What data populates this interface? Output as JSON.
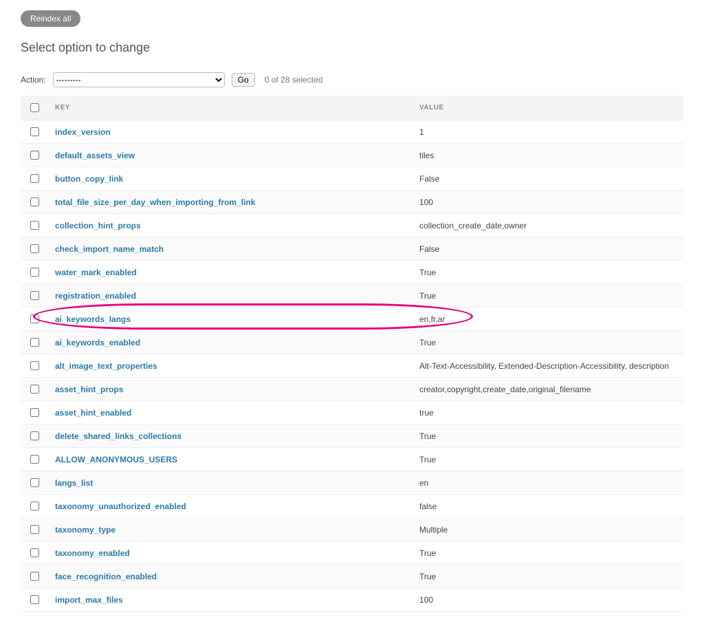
{
  "toolbar": {
    "reindex_label": "Reindex all"
  },
  "page_title": "Select option to change",
  "actions": {
    "label": "Action:",
    "placeholder": "---------",
    "go_label": "Go",
    "selection_count": "0 of 28 selected"
  },
  "table": {
    "header_key": "KEY",
    "header_value": "VALUE",
    "rows": [
      {
        "key": "index_version",
        "value": "1",
        "highlight": false
      },
      {
        "key": "default_assets_view",
        "value": "tiles",
        "highlight": false
      },
      {
        "key": "button_copy_link",
        "value": "False",
        "highlight": false
      },
      {
        "key": "total_file_size_per_day_when_importing_from_link",
        "value": "100",
        "highlight": false
      },
      {
        "key": "collection_hint_props",
        "value": "collection_create_date,owner",
        "highlight": false
      },
      {
        "key": "check_import_name_match",
        "value": "False",
        "highlight": false
      },
      {
        "key": "water_mark_enabled",
        "value": "True",
        "highlight": false
      },
      {
        "key": "registration_enabled",
        "value": "True",
        "highlight": false
      },
      {
        "key": "ai_keywords_langs",
        "value": "en,fr,ar",
        "highlight": true
      },
      {
        "key": "ai_keywords_enabled",
        "value": "True",
        "highlight": false
      },
      {
        "key": "alt_image_text_properties",
        "value": "Alt-Text-Accessibility, Extended-Description-Accessibility, description",
        "highlight": false
      },
      {
        "key": "asset_hint_props",
        "value": "creator,copyright,create_date,original_filename",
        "highlight": false
      },
      {
        "key": "asset_hint_enabled",
        "value": "true",
        "highlight": false
      },
      {
        "key": "delete_shared_links_collections",
        "value": "True",
        "highlight": false
      },
      {
        "key": "ALLOW_ANONYMOUS_USERS",
        "value": "True",
        "highlight": false
      },
      {
        "key": "langs_list",
        "value": "en",
        "highlight": false
      },
      {
        "key": "taxonomy_unauthorized_enabled",
        "value": "false",
        "highlight": false
      },
      {
        "key": "taxonomy_type",
        "value": "Multiple",
        "highlight": false
      },
      {
        "key": "taxonomy_enabled",
        "value": "True",
        "highlight": false
      },
      {
        "key": "face_recognition_enabled",
        "value": "True",
        "highlight": false
      },
      {
        "key": "import_max_files",
        "value": "100",
        "highlight": false
      }
    ]
  }
}
